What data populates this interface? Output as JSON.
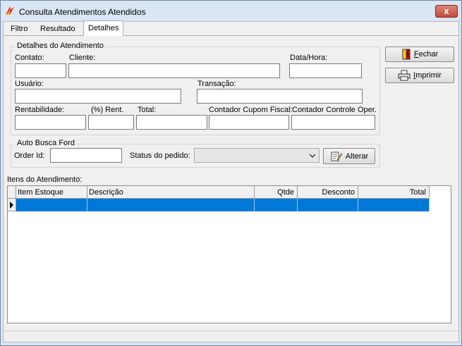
{
  "window": {
    "title": "Consulta Atendimentos Atendidos",
    "close_glyph": "x",
    "icon": "app-logo-icon"
  },
  "tabs": [
    {
      "label": "Filtro"
    },
    {
      "label": "Resultado"
    },
    {
      "label": "Detalhes",
      "active": true
    }
  ],
  "detalhes": {
    "group_title": "Detalhes do Atendimento",
    "labels": {
      "contato": "Contato:",
      "cliente": "Cliente:",
      "data_hora": "Data/Hora:",
      "usuario": "Usuário:",
      "transacao": "Transação:",
      "rentabilidade": "Rentabilidade:",
      "pct_rent": "(%) Rent.",
      "total": "Total:",
      "cupom_fiscal": "Contador Cupom Fiscal:",
      "controle_oper": "Contador Controle Oper."
    },
    "values": {
      "contato": "",
      "cliente": "",
      "data_hora": "",
      "usuario": "",
      "transacao": "",
      "rentabilidade": "",
      "pct_rent": "",
      "total": "",
      "cupom_fiscal": "",
      "controle_oper": ""
    }
  },
  "auto_busca": {
    "group_title": "Auto Busca Ford",
    "order_id_label": "Order Id:",
    "order_id_value": "",
    "status_label": "Status do pedido:",
    "status_value": "",
    "alterar_label": "Alterar"
  },
  "buttons": {
    "fechar": {
      "label_underlined": "F",
      "label_rest": "echar",
      "icon": "exit-door-icon"
    },
    "imprimir": {
      "label_underlined": "I",
      "label_rest": "mprimir",
      "icon": "printer-icon"
    }
  },
  "itens": {
    "title": "Itens do Atendimento:",
    "columns": [
      "Item Estoque",
      "Descrição",
      "Qtde",
      "Desconto",
      "Total"
    ],
    "rows": [
      {
        "item_estoque": "",
        "descricao": "",
        "qtde": "",
        "desconto": "",
        "total": ""
      }
    ]
  },
  "colors": {
    "title_bg": "#dbe6f4",
    "selection": "#0078d7",
    "close_button": "#c34a3a"
  }
}
